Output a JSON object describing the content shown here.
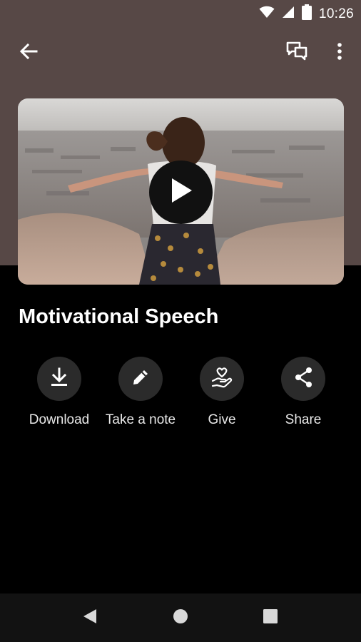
{
  "status_bar": {
    "time": "10:26",
    "icons": [
      "wifi-icon",
      "cell-signal-icon",
      "battery-icon"
    ]
  },
  "app_bar": {
    "back_icon": "arrow-left-icon",
    "chat_icon": "chat-bubbles-icon",
    "more_icon": "more-vertical-icon"
  },
  "video": {
    "play_icon": "play-icon"
  },
  "title": "Motivational Speech",
  "actions": [
    {
      "label": "Download",
      "icon": "download-icon"
    },
    {
      "label": "Take a note",
      "icon": "pencil-icon"
    },
    {
      "label": "Give",
      "icon": "heart-hand-icon"
    },
    {
      "label": "Share",
      "icon": "share-icon"
    }
  ],
  "nav_bar": {
    "icons": [
      "nav-back-icon",
      "nav-home-icon",
      "nav-recents-icon"
    ]
  },
  "colors": {
    "hero_background": "#574846",
    "screen_background": "#000000",
    "action_circle": "#2b2b2b",
    "nav_bar": "#121212"
  }
}
